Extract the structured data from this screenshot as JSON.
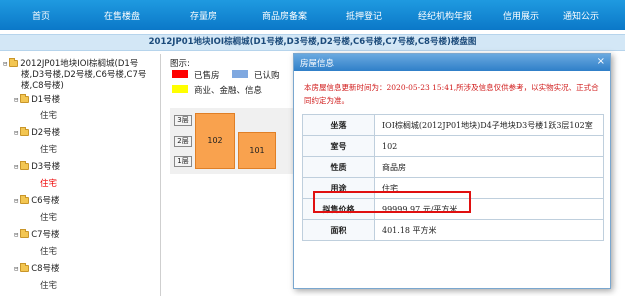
{
  "nav": [
    "首页",
    "在售楼盘",
    "存量房",
    "商品房备案",
    "抵押登记",
    "经纪机构年报",
    "信用展示",
    "通知公示"
  ],
  "page_title": "2012JP01地块IOI棕榈城(D1号楼,D3号楼,D2号楼,C6号楼,C7号楼,C8号楼)楼盘图",
  "tree": {
    "root_line1": "2012JP01地块IOI棕榈城(D1号",
    "root_line2": "楼,D3号楼,D2号楼,C6号楼,C7号",
    "root_line3": "楼,C8号楼)",
    "buildings": [
      {
        "name": "D1号楼",
        "leaf": "住宅",
        "selected": false
      },
      {
        "name": "D2号楼",
        "leaf": "住宅",
        "selected": false
      },
      {
        "name": "D3号楼",
        "leaf": "住宅",
        "selected": true
      },
      {
        "name": "C6号楼",
        "leaf": "住宅",
        "selected": false
      },
      {
        "name": "C7号楼",
        "leaf": "住宅",
        "selected": false
      },
      {
        "name": "C8号楼",
        "leaf": "住宅",
        "selected": false
      }
    ]
  },
  "legend": {
    "title": "图示:",
    "items": [
      {
        "label": "已售房",
        "color": "#ff0000"
      },
      {
        "label": "已认购",
        "color": "#7fa8e0"
      },
      {
        "label": "商业、金融、信息",
        "color": "#ffff00"
      }
    ]
  },
  "diagram": {
    "floors": [
      "3层",
      "2层",
      "1层"
    ],
    "units": [
      "102",
      "101"
    ]
  },
  "modal": {
    "title": "房屋信息",
    "close": "×",
    "notice": "本房屋信息更新时间为：2020-05-23 15:41,所涉及信息仅供参考，以实物实况、正式合同约定为准。",
    "rows": [
      {
        "key": "坐落",
        "value": "IOI棕榈城(2012JP01地块)D4子地块D3号楼1跃3层102室"
      },
      {
        "key": "室号",
        "value": "102"
      },
      {
        "key": "性质",
        "value": "商品房"
      },
      {
        "key": "用途",
        "value": "住宅"
      },
      {
        "key": "拟售价格",
        "value": "99999.97 元/平方米"
      },
      {
        "key": "面积",
        "value": "401.18 平方米"
      }
    ]
  }
}
